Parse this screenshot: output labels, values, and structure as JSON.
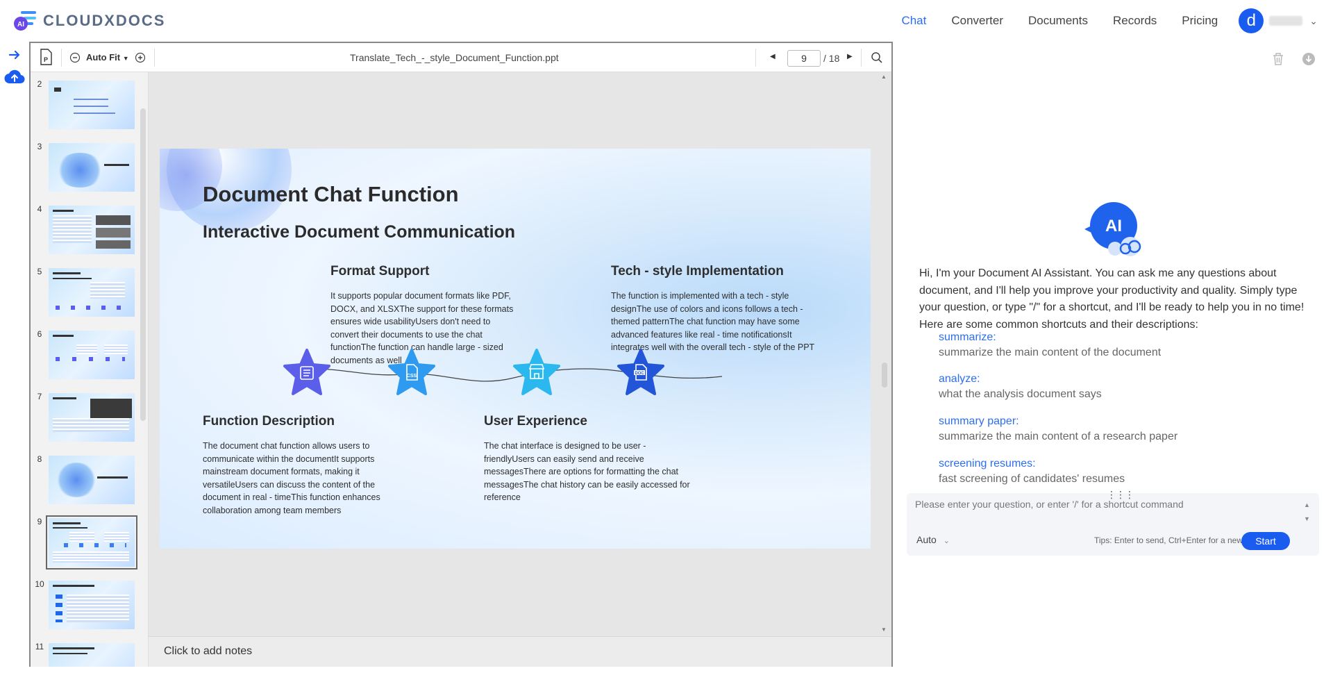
{
  "brand": {
    "name": "CLOUDXDOCS"
  },
  "nav": {
    "items": [
      {
        "label": "Chat",
        "active": true
      },
      {
        "label": "Converter",
        "active": false
      },
      {
        "label": "Documents",
        "active": false
      },
      {
        "label": "Records",
        "active": false
      },
      {
        "label": "Pricing",
        "active": false
      }
    ],
    "avatar_letter": "d"
  },
  "viewer": {
    "zoom": "Auto Fit",
    "filename": "Translate_Tech_-_style_Document_Function.ppt",
    "current_page": "9",
    "total_pages": "/ 18",
    "notes_placeholder": "Click to add notes",
    "thumbnails": [
      "2",
      "3",
      "4",
      "5",
      "6",
      "7",
      "8",
      "9",
      "10",
      "11"
    ],
    "selected_thumbnail": "9"
  },
  "slide": {
    "title": "Document Chat Function",
    "subtitle": "Interactive Document Communication",
    "sections": {
      "format_support": {
        "heading": "Format Support",
        "body": "It supports popular document formats like PDF, DOCX, and XLSXThe support for these formats ensures wide usabilityUsers don't need to convert their documents to use the chat functionThe function can handle large - sized documents as well"
      },
      "tech_style": {
        "heading": "Tech - style Implementation",
        "body": "The function is implemented with a tech - style designThe use of colors and icons follows a tech - themed patternThe chat function may have some advanced features like real - time notificationsIt integrates well with the overall tech - style of the PPT"
      },
      "function_description": {
        "heading": "Function Description",
        "body": "The document chat function allows users to communicate within the documentIt supports mainstream document formats, making it versatileUsers can discuss the content of the document in real - timeThis function enhances collaboration among team members"
      },
      "user_experience": {
        "heading": "User Experience",
        "body": "The chat interface is designed to be user - friendlyUsers can easily send and receive messagesThere are options for formatting the chat messagesThe chat history can be easily accessed for reference"
      }
    },
    "star_icons": [
      "list-icon",
      "css-file-icon",
      "store-icon",
      "doc-file-icon"
    ],
    "star_colors": [
      "#5a5ee8",
      "#2f9bf0",
      "#2ab8ee",
      "#2355d8"
    ]
  },
  "chat": {
    "ai_badge": "AI",
    "intro": "Hi, I'm your Document AI Assistant. You can ask me any questions about document, and I'll help you improve your productivity and quality. Simply type your question, or type \"/\" for a shortcut, and I'll be ready to help you in no time! Here are some common shortcuts and their descriptions:",
    "shortcuts": [
      {
        "key": "summarize:",
        "desc": "summarize the main content of the document"
      },
      {
        "key": "analyze:",
        "desc": "what the analysis document says"
      },
      {
        "key": "summary paper:",
        "desc": "summarize the main content of a research paper"
      },
      {
        "key": "screening resumes:",
        "desc": "fast screening of candidates' resumes"
      }
    ],
    "input_placeholder": "Please enter your question, or enter '/' for a shortcut command",
    "mode": "Auto",
    "tips": "Tips: Enter to send, Ctrl+Enter for a new line",
    "send_label": "Start"
  },
  "colors": {
    "accent": "#2b6ef2",
    "brand_blue": "#1a5cf0"
  }
}
